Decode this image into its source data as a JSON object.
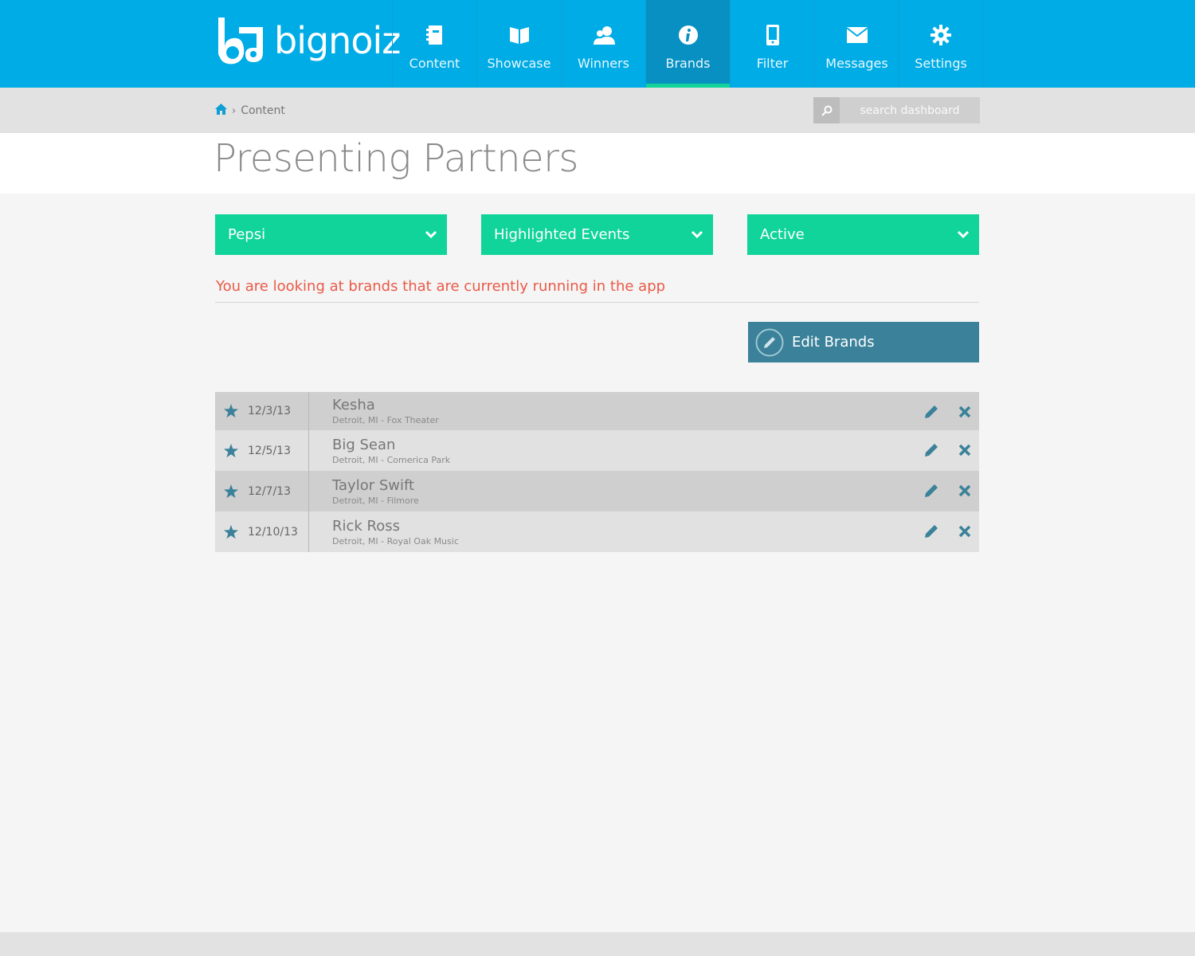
{
  "app": {
    "brand": "bignoiz",
    "colors": {
      "primary": "#00ace6",
      "accent": "#10d49a",
      "button": "#3a8199",
      "notice": "#e95a47"
    }
  },
  "nav": {
    "items": [
      {
        "label": "Content",
        "icon": "notebook-icon"
      },
      {
        "label": "Showcase",
        "icon": "open-book-icon"
      },
      {
        "label": "Winners",
        "icon": "users-icon"
      },
      {
        "label": "Brands",
        "icon": "info-icon",
        "active": true
      },
      {
        "label": "Filter",
        "icon": "phone-icon"
      },
      {
        "label": "Messages",
        "icon": "envelope-icon"
      },
      {
        "label": "Settings",
        "icon": "gear-icon"
      }
    ]
  },
  "breadcrumb": {
    "current": "Content"
  },
  "search": {
    "placeholder": "search dashboard"
  },
  "page": {
    "title": "Presenting Partners"
  },
  "filters": {
    "brand": "Pepsi",
    "category": "Highlighted Events",
    "status": "Active"
  },
  "notice": "You are looking at brands that are currently running in the app",
  "edit_button": {
    "label": "Edit Brands"
  },
  "events": [
    {
      "date": "12/3/13",
      "name": "Kesha",
      "venue": "Detroit, MI - Fox Theater"
    },
    {
      "date": "12/5/13",
      "name": "Big Sean",
      "venue": "Detroit, MI - Comerica Park"
    },
    {
      "date": "12/7/13",
      "name": "Taylor Swift",
      "venue": "Detroit, MI - Filmore"
    },
    {
      "date": "12/10/13",
      "name": "Rick Ross",
      "venue": "Detroit, MI - Royal Oak Music"
    }
  ]
}
